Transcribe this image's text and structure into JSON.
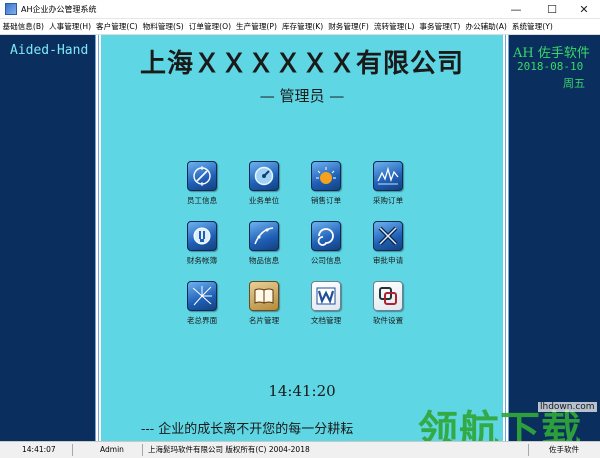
{
  "window": {
    "title": "AH企业办公管理系统",
    "minimize_glyph": "—",
    "maximize_glyph": "☐",
    "close_glyph": "✕"
  },
  "menu": [
    {
      "label": "基础信息(B)"
    },
    {
      "label": "人事管理(H)"
    },
    {
      "label": "客户管理(C)"
    },
    {
      "label": "物料管理(S)"
    },
    {
      "label": "订单管理(O)"
    },
    {
      "label": "生产管理(P)"
    },
    {
      "label": "库存管理(K)"
    },
    {
      "label": "财务管理(F)"
    },
    {
      "label": "流转管理(L)"
    },
    {
      "label": "事务管理(T)"
    },
    {
      "label": "办公辅助(A)"
    },
    {
      "label": "系统管理(Y)"
    }
  ],
  "left_panel": {
    "brand_text": "Aided-Hand"
  },
  "right_panel": {
    "brand_text": "AH 佐手软件",
    "date": "2018-08-10",
    "weekday": "周五"
  },
  "main": {
    "company_name": "上海ＸＸＸＸＸＸ有限公司",
    "role": "— 管理员 —",
    "clock": "14:41:20",
    "slogan": "--- 企业的成长离不开您的每一分耕耘"
  },
  "tiles": [
    {
      "label": "员工信息",
      "icon": "compass-icon",
      "style": "blue"
    },
    {
      "label": "业务单位",
      "icon": "gauge-icon",
      "style": "blue"
    },
    {
      "label": "销售订单",
      "icon": "sunrise-icon",
      "style": "blue"
    },
    {
      "label": "采购订单",
      "icon": "chart-icon",
      "style": "blue"
    },
    {
      "label": "财务帐簿",
      "icon": "plug-icon",
      "style": "blue"
    },
    {
      "label": "物品信息",
      "icon": "curve-icon",
      "style": "blue"
    },
    {
      "label": "公司信息",
      "icon": "swirl-icon",
      "style": "blue"
    },
    {
      "label": "审批申请",
      "icon": "x-logo-icon",
      "style": "blue"
    },
    {
      "label": "老总界面",
      "icon": "shatter-icon",
      "style": "blue"
    },
    {
      "label": "名片管理",
      "icon": "book-icon",
      "style": "tan"
    },
    {
      "label": "文档管理",
      "icon": "word-doc-icon",
      "style": "light"
    },
    {
      "label": "软件设置",
      "icon": "settings-window-icon",
      "style": "light"
    }
  ],
  "status": {
    "time": "14:41:07",
    "user": "Admin",
    "copyright": "上海髭玛软件有限公司 版权所有(C) 2004-2018",
    "brand": "佐手软件"
  },
  "watermark": {
    "site": "lhdown.com",
    "logo": "领航下载"
  },
  "colors": {
    "main_bg": "#5fd6e4",
    "side_bg": "#0a2e5e",
    "side_text_cyan": "#7fe7f2",
    "side_text_green": "#38d868",
    "watermark_green": "#2fa83a"
  }
}
